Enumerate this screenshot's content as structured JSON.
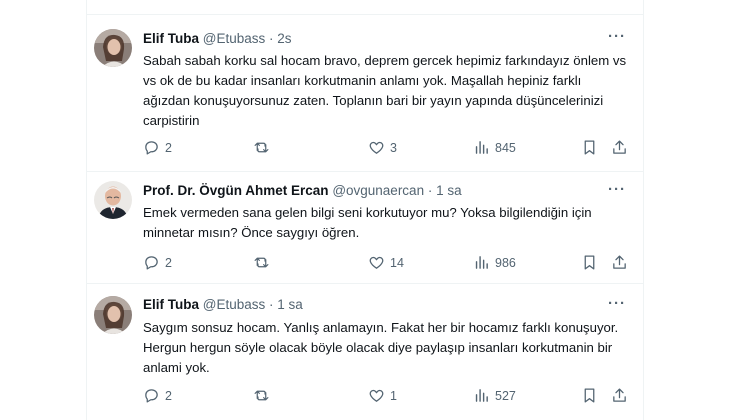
{
  "tweets": [
    {
      "name": "Elif Tuba",
      "handle": "@Etubass",
      "time": "2s",
      "text": "Sabah sabah korku sal hocam bravo, deprem gercek hepimiz farkındayız önlem vs vs ok de bu kadar insanları korkutmanin anlamı yok. Maşallah hepiniz farklı ağızdan konuşuyorsunuz zaten. Toplanın bari bir yayın yapında düşüncelerinizi carpistirin",
      "replies": "2",
      "retweets": "",
      "likes": "3",
      "views": "845"
    },
    {
      "name": "Prof. Dr. Övgün Ahmet Ercan",
      "handle": "@ovgunaercan",
      "time": "1 sa",
      "text": "Emek vermeden sana gelen bilgi seni korkutuyor mu? Yoksa bilgilendiğin için minnetar mısın? Önce saygıyı öğren.",
      "replies": "2",
      "retweets": "",
      "likes": "14",
      "views": "986"
    },
    {
      "name": "Elif Tuba",
      "handle": "@Etubass",
      "time": "1 sa",
      "text": "Saygım sonsuz hocam. Yanlış anlamayın. Fakat her bir hocamız farklı konuşuyor.  Hergun hergun söyle olacak böyle olacak diye paylaşıp insanları korkutmanin bir anlami yok.",
      "replies": "2",
      "retweets": "",
      "likes": "1",
      "views": "527"
    }
  ],
  "separator": "·",
  "more_label": "···",
  "colors": {
    "text": "#0f1419",
    "secondary": "#536471",
    "border": "#eff3f4"
  },
  "icons": [
    "reply-icon",
    "retweet-icon",
    "like-icon",
    "views-icon",
    "bookmark-icon",
    "share-icon",
    "more-icon"
  ]
}
